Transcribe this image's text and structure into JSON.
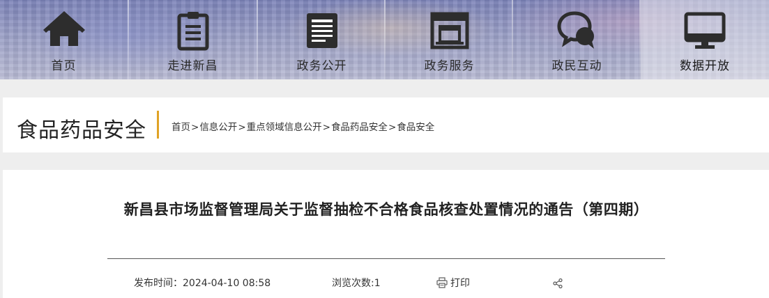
{
  "nav": {
    "items": [
      {
        "label": "首页",
        "icon": "home-icon"
      },
      {
        "label": "走进新昌",
        "icon": "document-list-icon"
      },
      {
        "label": "政务公开",
        "icon": "document-icon"
      },
      {
        "label": "政务服务",
        "icon": "service-window-icon"
      },
      {
        "label": "政民互动",
        "icon": "chat-bubbles-icon"
      },
      {
        "label": "数据开放",
        "icon": "monitor-icon"
      }
    ],
    "active_index": 5
  },
  "section": {
    "title": "食品药品安全",
    "accent_color": "#e0a325"
  },
  "breadcrumb": [
    "首页",
    "信息公开",
    "重点领域信息公开",
    "食品药品安全",
    "食品安全"
  ],
  "breadcrumb_sep": ">",
  "article": {
    "title": "新昌县市场监督管理局关于监督抽检不合格食品核查处置情况的通告（第四期）",
    "publish_label": "发布时间：",
    "publish_time": "2024-04-10 08:58",
    "views_label": "浏览次数:",
    "views": "1",
    "print_label": "打印",
    "print_icon": "printer-icon",
    "share_icon": "share-icon"
  }
}
